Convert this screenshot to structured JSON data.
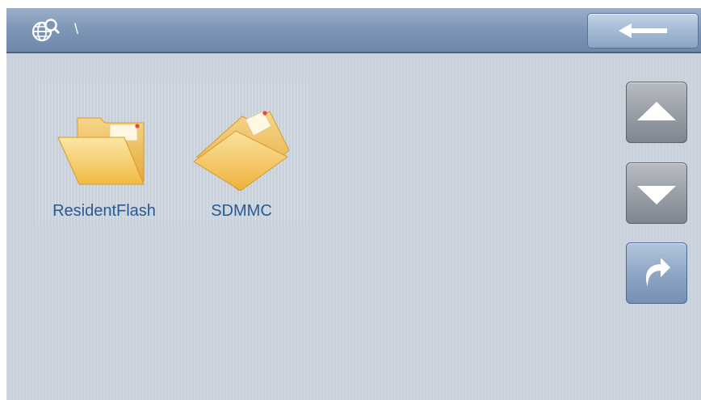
{
  "titlebar": {
    "path": "\\",
    "globe_icon": "globe-search-icon"
  },
  "back_button": {
    "icon": "arrow-left-icon"
  },
  "files": [
    {
      "label": "ResidentFlash",
      "icon": "folder-open-icon"
    },
    {
      "label": "SDMMC",
      "icon": "folder-icon"
    }
  ],
  "side_buttons": {
    "up_icon": "triangle-up-icon",
    "down_icon": "triangle-down-icon",
    "enter_icon": "curved-arrow-right-icon"
  },
  "colors": {
    "background": "#c8d1dc",
    "titlebar": "#7f97b7",
    "label_text": "#2a5a92",
    "folder": "#f3c45a"
  }
}
